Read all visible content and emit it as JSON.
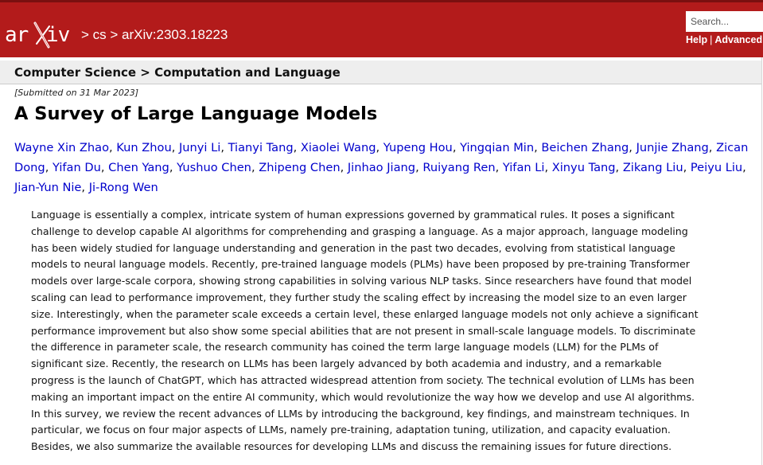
{
  "header": {
    "logo_text": "arXiv",
    "breadcrumbs": [
      {
        "label": "> cs"
      },
      {
        "label": "> arXiv:2303.18223"
      }
    ],
    "search_placeholder": "Search...",
    "help_label": "Help",
    "link_separator": "|",
    "advanced_label": "Advanced",
    "brand_color": "#b31b1b"
  },
  "subheader": {
    "category": "Computer Science > Computation and Language"
  },
  "paper": {
    "dateline": "[Submitted on 31 Mar 2023]",
    "title": "A Survey of Large Language Models",
    "authors": [
      "Wayne Xin Zhao",
      "Kun Zhou",
      "Junyi Li",
      "Tianyi Tang",
      "Xiaolei Wang",
      "Yupeng Hou",
      "Yingqian Min",
      "Beichen Zhang",
      "Junjie Zhang",
      "Zican Dong",
      "Yifan Du",
      "Chen Yang",
      "Yushuo Chen",
      "Zhipeng Chen",
      "Jinhao Jiang",
      "Ruiyang Ren",
      "Yifan Li",
      "Xinyu Tang",
      "Zikang Liu",
      "Peiyu Liu",
      "Jian-Yun Nie",
      "Ji-Rong Wen"
    ],
    "author_link_color": "#0000cc",
    "abstract_lines": [
      "Language is essentially a complex, intricate system of human expressions governed by grammatical rules. It poses a significant",
      "challenge to develop capable AI algorithms for comprehending and grasping a language. As a major approach, language modeling",
      "has been widely studied for language understanding and generation in the past two decades, evolving from statistical language",
      "models to neural language models. Recently, pre-trained language models (PLMs) have been proposed by pre-training Transformer",
      "models over large-scale corpora, showing strong capabilities in solving various NLP tasks. Since researchers have found that model",
      "scaling can lead to performance improvement, they further study the scaling effect by increasing the model size to an even larger",
      "size. Interestingly, when the parameter scale exceeds a certain level, these enlarged language models not only achieve a significant",
      "performance improvement but also show some special abilities that are not present in small-scale language models. To discriminate",
      "the difference in parameter scale, the research community has coined the term large language models (LLM) for the PLMs of",
      "significant size. Recently, the research on LLMs has been largely advanced by both academia and industry, and a remarkable",
      "progress is the launch of ChatGPT, which has attracted widespread attention from society. The technical evolution of LLMs has been",
      "making an important impact on the entire AI community, which would revolutionize the way how we develop and use AI algorithms.",
      "In this survey, we review the recent advances of LLMs by introducing the background, key findings, and mainstream techniques. In",
      "particular, we focus on four major aspects of LLMs, namely pre-training, adaptation tuning, utilization, and capacity evaluation.",
      "Besides, we also summarize the available resources for developing LLMs and discuss the remaining issues for future directions."
    ]
  }
}
